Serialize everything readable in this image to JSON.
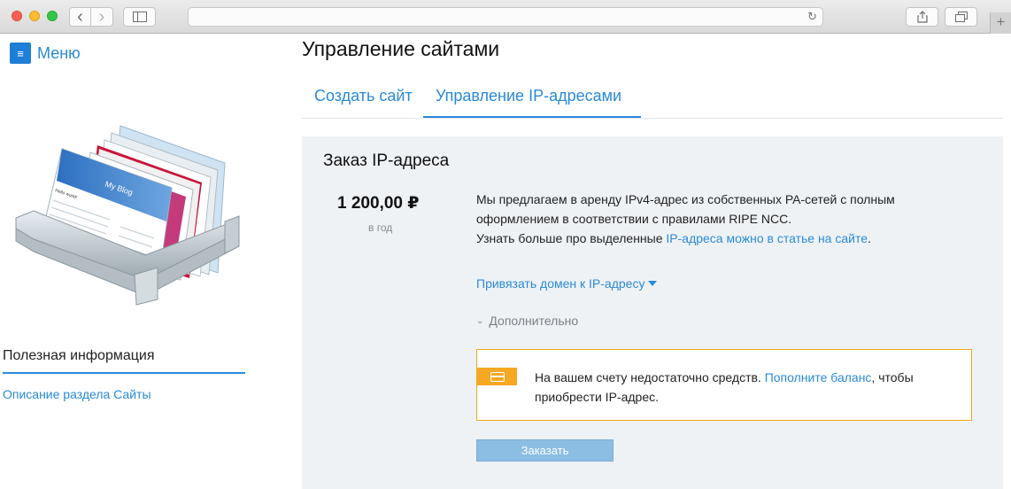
{
  "browser": {
    "back_glyph": "‹",
    "forward_glyph": "›",
    "reload_glyph": "↻",
    "new_tab_glyph": "+"
  },
  "sidebar": {
    "menu_icon": "≡",
    "menu_label": "Меню",
    "useful_title": "Полезная информация",
    "useful_link": "Описание раздела Сайты",
    "illustration": {
      "blog_title": "My Blog",
      "post_title": "Hello world!"
    }
  },
  "main": {
    "page_title": "Управление сайтами",
    "tabs": [
      {
        "label": "Создать сайт"
      },
      {
        "label": "Управление IP-адресами",
        "active": true
      }
    ],
    "order_panel": {
      "title": "Заказ IP-адреса",
      "price": "1 200,00 ₽",
      "period": "в год",
      "description_line1": "Мы предлагаем в аренду IPv4-адрес из собственных PA-сетей с полным оформлением в соответствии с правилами RIPE NCC.",
      "description_line2_prefix": "Узнать больше про выделенные ",
      "description_link": "IP-адреса можно в статье на сайте",
      "description_line2_suffix": ".",
      "bind_domain_link": "Привязать домен к IP-адресу",
      "extra_label": "Дополнительно",
      "alert": {
        "text_prefix": "На вашем счету недостаточно средств. ",
        "link": "Пополните баланс",
        "text_suffix": ", чтобы приобрести IP-адрес."
      },
      "order_button": "Заказать"
    }
  },
  "colors": {
    "accent": "#2a8ad8",
    "panel_bg": "#eff2f5",
    "alert_border": "#f0a818",
    "alert_icon_bg": "#f7a823",
    "button_disabled_bg": "#8cbde2"
  }
}
